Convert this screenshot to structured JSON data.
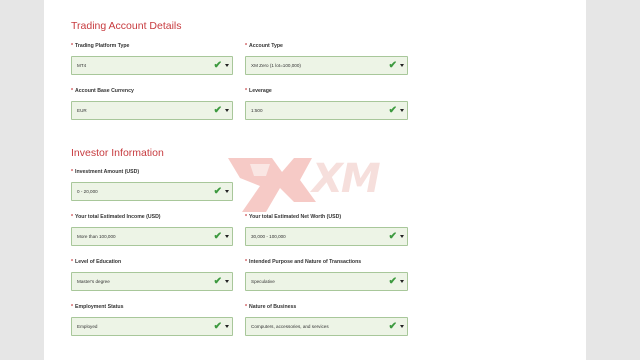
{
  "sections": {
    "trading": {
      "title": "Trading Account Details"
    },
    "investor": {
      "title": "Investor Information"
    }
  },
  "fields": {
    "platform": {
      "label": "Trading Platform Type",
      "value": "MT4"
    },
    "account_type": {
      "label": "Account Type",
      "value": "XM Zero (1 lot=100,000)"
    },
    "base_currency": {
      "label": "Account Base Currency",
      "value": "EUR"
    },
    "leverage": {
      "label": "Leverage",
      "value": "1:500"
    },
    "investment": {
      "label": "Investment Amount (USD)",
      "value": "0 - 20,000"
    },
    "income": {
      "label": "Your total Estimated Income (USD)",
      "value": "More than 100,000"
    },
    "net_worth": {
      "label": "Your total Estimated Net Worth (USD)",
      "value": "30,000 - 100,000"
    },
    "education": {
      "label": "Level of Education",
      "value": "Master's degree"
    },
    "purpose": {
      "label": "Intended Purpose and Nature of Transactions",
      "value": "Speculative"
    },
    "employment": {
      "label": "Employment Status",
      "value": "Employed"
    },
    "business": {
      "label": "Nature of Business",
      "value": "Computers, accessories, and services"
    }
  },
  "watermark": {
    "text": "XM"
  },
  "colors": {
    "accent": "#c73b3f",
    "valid_bg": "#edf4e6",
    "check": "#3d9a3f"
  },
  "icons": {
    "check": "check-icon",
    "caret": "chevron-down-icon"
  }
}
